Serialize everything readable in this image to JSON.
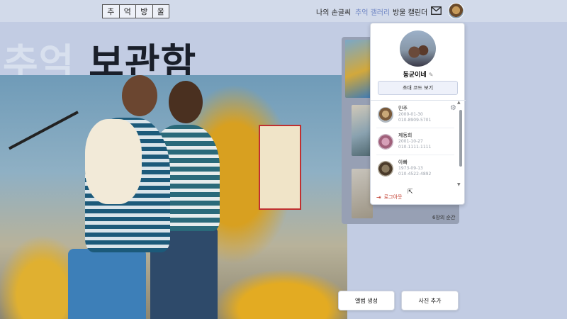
{
  "header": {
    "logo_chars": [
      "추",
      "억",
      "방",
      "울"
    ],
    "nav": [
      {
        "label": "나의 손글씨",
        "active": false
      },
      {
        "label": "추억 갤러리",
        "active": true
      },
      {
        "label": "방울 캘린더",
        "active": false
      }
    ],
    "mail_icon": "mail-icon",
    "avatar_icon": "avatar"
  },
  "hero": {
    "title_light": "추억 ",
    "title_dark": "보관함"
  },
  "gallery": {
    "moments_label": "6장의 순간"
  },
  "profile_menu": {
    "name": "동균이네",
    "edit_icon": "pencil-icon",
    "invite_label": "초대 코드 보기",
    "members": [
      {
        "name": "민주",
        "birth": "2000-01-30",
        "phone": "010-8909-5701",
        "settings_icon": "gear-icon"
      },
      {
        "name": "제동희",
        "birth": "2001-10-27",
        "phone": "010-1111-1111"
      },
      {
        "name": "아빠",
        "birth": "1973-09-13",
        "phone": "010-4522-4892"
      }
    ],
    "logout_label": "로그아웃",
    "logout_icon": "logout-icon"
  },
  "actions": {
    "create_album_label": "앨범 생성",
    "add_photo_label": "사진 추가"
  },
  "colors": {
    "page_bg": "#c2cce3",
    "header_bg": "#d2daea",
    "active_nav": "#6f86c4",
    "logout": "#c0392b"
  }
}
